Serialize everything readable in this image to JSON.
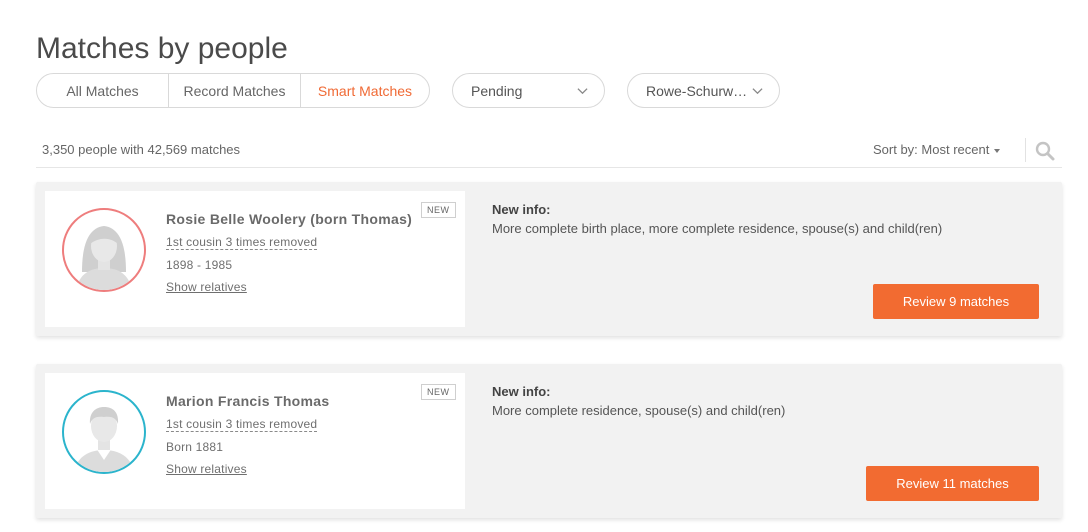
{
  "page": {
    "title": "Matches by people"
  },
  "filters": {
    "tabs": [
      {
        "label": "All Matches",
        "active": false
      },
      {
        "label": "Record Matches",
        "active": false
      },
      {
        "label": "Smart Matches",
        "active": true
      }
    ],
    "status": {
      "value": "Pending"
    },
    "tree": {
      "value": "Rowe-Schurw…"
    }
  },
  "summary": "3,350 people with 42,569 matches",
  "sort": {
    "label": "Sort by:",
    "value": "Most recent"
  },
  "colors": {
    "accent": "#f26b31",
    "female_ring": "#ee7d7d",
    "male_ring": "#2bb4cc"
  },
  "matches": [
    {
      "name": "Rosie Belle Woolery (born Thomas)",
      "relationship": "1st cousin 3 times removed",
      "dates": "1898 - 1985",
      "show_relatives": "Show relatives",
      "badge": "NEW",
      "gender": "female",
      "info_title": "New info:",
      "info_text": "More complete birth place, more complete residence, spouse(s) and child(ren)",
      "button": "Review 9 matches"
    },
    {
      "name": "Marion Francis Thomas",
      "relationship": "1st cousin 3 times removed",
      "dates": "Born 1881",
      "show_relatives": "Show relatives",
      "badge": "NEW",
      "gender": "male",
      "info_title": "New info:",
      "info_text": "More complete residence, spouse(s) and child(ren)",
      "button": "Review 11 matches"
    }
  ]
}
